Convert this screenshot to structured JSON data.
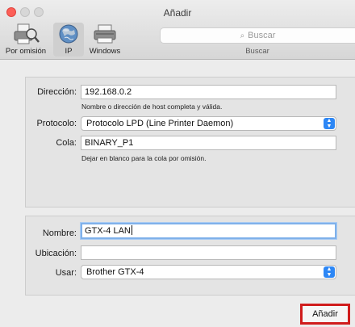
{
  "window": {
    "title": "Añadir"
  },
  "toolbar": {
    "items": [
      {
        "label": "Por omisión",
        "icon": "default-printer-icon"
      },
      {
        "label": "IP",
        "icon": "globe-icon",
        "selected": true
      },
      {
        "label": "Windows",
        "icon": "windows-printer-icon"
      }
    ],
    "search": {
      "placeholder": "Buscar",
      "caption": "Buscar"
    }
  },
  "form": {
    "address": {
      "label": "Dirección:",
      "value": "192.168.0.2",
      "hint": "Nombre o dirección de host completa y válida."
    },
    "protocol": {
      "label": "Protocolo:",
      "value": "Protocolo LPD (Line Printer Daemon)"
    },
    "queue": {
      "label": "Cola:",
      "value": "BINARY_P1",
      "hint": "Dejar en blanco para la cola por omisión."
    },
    "name": {
      "label": "Nombre:",
      "value": "GTX-4 LAN"
    },
    "location": {
      "label": "Ubicación:",
      "value": ""
    },
    "use": {
      "label": "Usar:",
      "value": "Brother GTX-4"
    }
  },
  "actions": {
    "add_label": "Añadir",
    "highlight_color": "#d01c1c"
  },
  "colors": {
    "accent": "#2d87f5",
    "close": "#fc5f57"
  }
}
